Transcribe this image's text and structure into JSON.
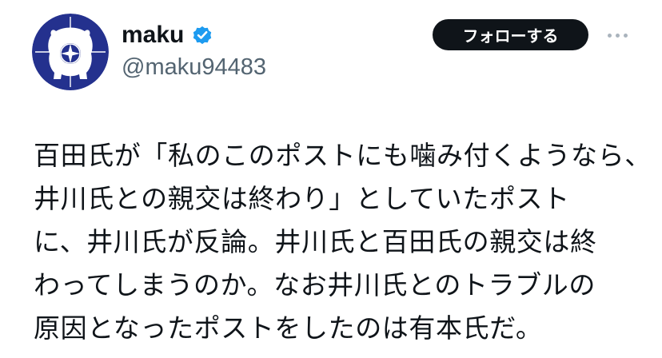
{
  "profile": {
    "display_name": "maku",
    "handle": "@maku94483",
    "verified": true,
    "avatar_icon": "nato-emblem-bear-avatar"
  },
  "actions": {
    "follow_label": "フォローする",
    "more_icon": "more-dots-icon"
  },
  "post": {
    "lines": [
      "百田氏が「私のこのポストにも噛み付くようなら、井川氏との親交は終わり」としていたポストに、井川氏が反論。井川氏と百田氏の親交は終わってしまうのか。なお井川氏とのトラブルの原因となったポストをしたのは有本氏だ。"
    ]
  },
  "colors": {
    "text_primary": "#0f1419",
    "text_secondary": "#536471",
    "verified_blue": "#1d9bf0",
    "avatar_bg": "#24318e",
    "button_bg": "#0f1419",
    "button_text": "#ffffff"
  }
}
